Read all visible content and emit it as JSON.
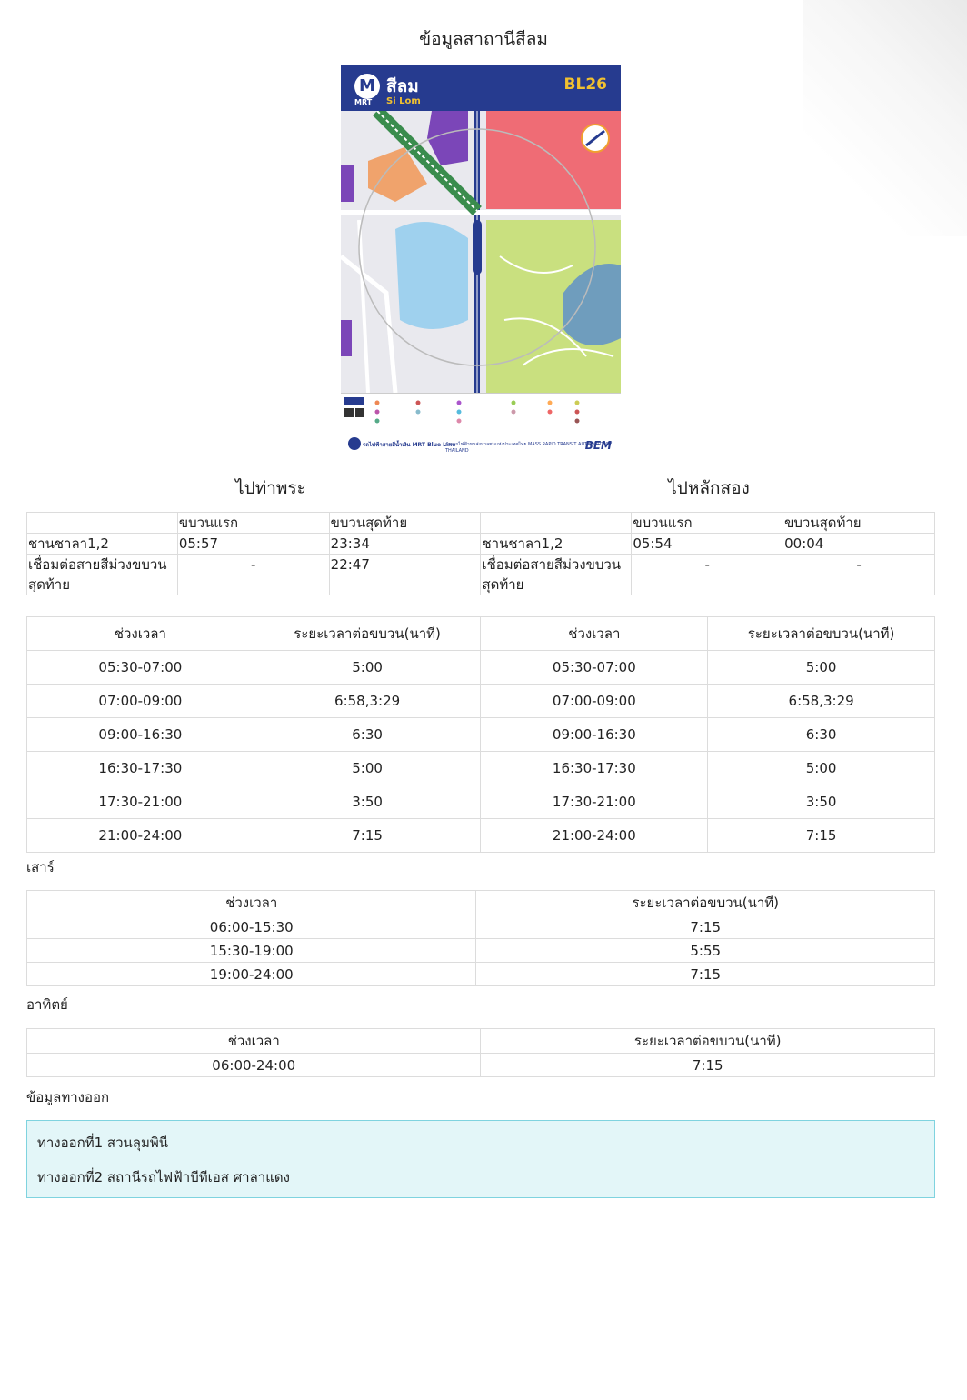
{
  "page": {
    "title": "ข้อมูลสาถานีสีลม"
  },
  "map": {
    "logo": "M",
    "logo_sub": "MRT",
    "station_th": "สีลม",
    "station_en": "Si Lom",
    "code": "BL26",
    "footer_line": "รถไฟฟ้าสายสีน้ำเงิน MRT Blue Line",
    "footer_authority": "การรถไฟฟ้าขนส่งมวลชนแห่งประเทศไทย MASS RAPID TRANSIT AUTHORITY OF THAILAND",
    "footer_brand": "BEM",
    "colors": {
      "header": "#263b8f",
      "accent": "#f0c030",
      "park": "#c9e07f",
      "hospital": "#ef6c75",
      "water": "#9fd1ee",
      "office": "#7b46b8",
      "orange": "#f0a36c"
    }
  },
  "directions": [
    {
      "label": "ไปท่าพระ"
    },
    {
      "label": "ไปหลักสอง"
    }
  ],
  "first_last": {
    "headers": [
      "",
      "ขบวนแรก",
      "ขบวนสุดท้าย",
      "",
      "ขบวนแรก",
      "ขบวนสุดท้าย"
    ],
    "rows": [
      [
        "ชานชาลา1,2",
        "05:57",
        "23:34",
        "ชานชาลา1,2",
        "05:54",
        "00:04"
      ],
      [
        "เชื่อมต่อสายสีม่วงขบวนสุดท้าย",
        "-",
        "22:47",
        "เชื่อมต่อสายสีม่วงขบวนสุดท้าย",
        "-",
        "-"
      ]
    ]
  },
  "weekday": {
    "headers": [
      "ช่วงเวลา",
      "ระยะเวลาต่อขบวน(นาที)",
      "ช่วงเวลา",
      "ระยะเวลาต่อขบวน(นาที)"
    ],
    "rows": [
      [
        "05:30-07:00",
        "5:00",
        "05:30-07:00",
        "5:00"
      ],
      [
        "07:00-09:00",
        "6:58,3:29",
        "07:00-09:00",
        "6:58,3:29"
      ],
      [
        "09:00-16:30",
        "6:30",
        "09:00-16:30",
        "6:30"
      ],
      [
        "16:30-17:30",
        "5:00",
        "16:30-17:30",
        "5:00"
      ],
      [
        "17:30-21:00",
        "3:50",
        "17:30-21:00",
        "3:50"
      ],
      [
        "21:00-24:00",
        "7:15",
        "21:00-24:00",
        "7:15"
      ]
    ]
  },
  "saturday": {
    "label": "เสาร์",
    "headers": [
      "ช่วงเวลา",
      "ระยะเวลาต่อขบวน(นาที)"
    ],
    "rows": [
      [
        "06:00-15:30",
        "7:15"
      ],
      [
        "15:30-19:00",
        "5:55"
      ],
      [
        "19:00-24:00",
        "7:15"
      ]
    ]
  },
  "sunday": {
    "label": "อาทิตย์",
    "headers": [
      "ช่วงเวลา",
      "ระยะเวลาต่อขบวน(นาที)"
    ],
    "rows": [
      [
        "06:00-24:00",
        "7:15"
      ]
    ]
  },
  "exits": {
    "label": "ข้อมูลทางออก",
    "items": [
      "ทางออกที่1 สวนลุมพินี",
      "ทางออกที่2 สถานีรถไฟฟ้าบีทีเอส ศาลาแดง"
    ]
  }
}
